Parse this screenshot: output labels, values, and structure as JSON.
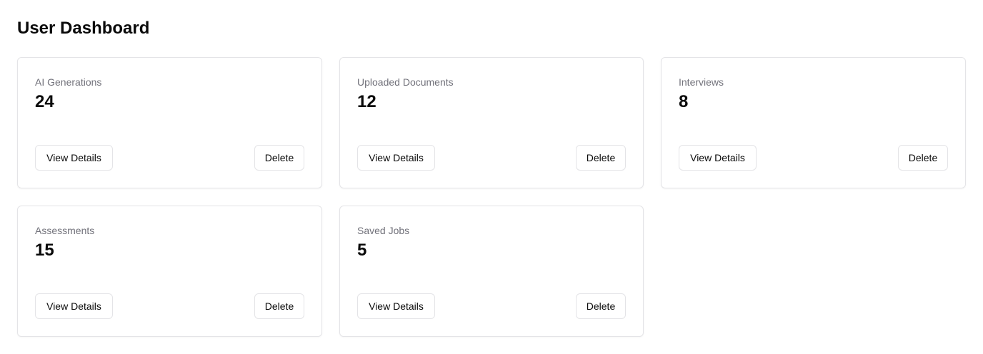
{
  "header": {
    "title": "User Dashboard"
  },
  "cards": [
    {
      "label": "AI Generations",
      "value": "24",
      "view_label": "View Details",
      "delete_label": "Delete"
    },
    {
      "label": "Uploaded Documents",
      "value": "12",
      "view_label": "View Details",
      "delete_label": "Delete"
    },
    {
      "label": "Interviews",
      "value": "8",
      "view_label": "View Details",
      "delete_label": "Delete"
    },
    {
      "label": "Assessments",
      "value": "15",
      "view_label": "View Details",
      "delete_label": "Delete"
    },
    {
      "label": "Saved Jobs",
      "value": "5",
      "view_label": "View Details",
      "delete_label": "Delete"
    }
  ],
  "colors": {
    "border": "#e4e4e7",
    "muted_text": "#71717a",
    "text": "#0a0a0a",
    "background": "#ffffff"
  }
}
